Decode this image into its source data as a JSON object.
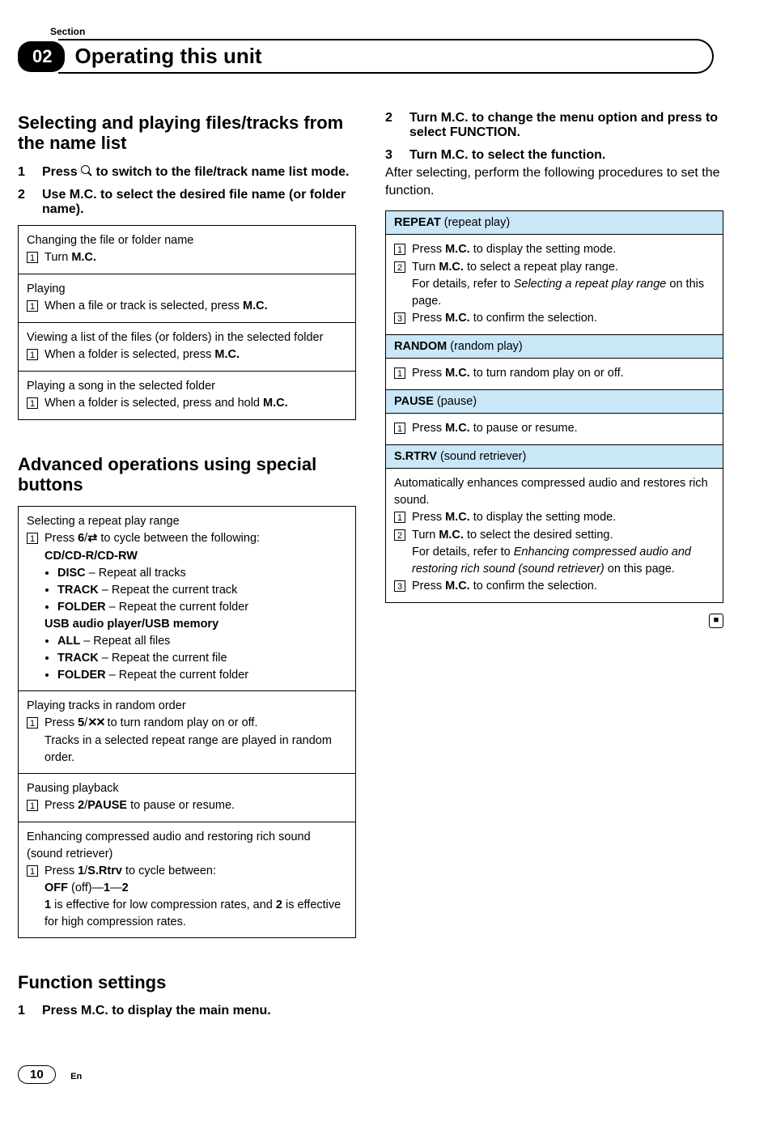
{
  "header": {
    "section_label": "Section",
    "chapter_number": "02",
    "chapter_title": "Operating this unit"
  },
  "left": {
    "h1": "Selecting and playing files/tracks from the name list",
    "step1_num": "1",
    "step1_a": "Press ",
    "step1_b": " to switch to the file/track name list mode.",
    "step2_num": "2",
    "step2": "Use M.C. to select the desired file name (or folder name).",
    "box1": {
      "r1_title": "Changing the file or folder name",
      "r1_item": "Turn ",
      "r1_item_b": "M.C.",
      "r2_title": "Playing",
      "r2_item_a": "When a file or track is selected, press ",
      "r2_item_b": "M.C.",
      "r3_title": "Viewing a list of the files (or folders) in the selected folder",
      "r3_item_a": "When a folder is selected, press ",
      "r3_item_b": "M.C.",
      "r4_title": "Playing a song in the selected folder",
      "r4_item_a": "When a folder is selected, press and hold ",
      "r4_item_b": "M.C."
    },
    "h2": "Advanced operations using special buttons",
    "box2": {
      "r1_title": "Selecting a repeat play range",
      "r1_press_a": "Press ",
      "r1_press_key": "6",
      "r1_press_b": " to cycle between the following:",
      "r1_sub1": "CD/CD-R/CD-RW",
      "r1_b1_b": "DISC",
      "r1_b1_t": " – Repeat all tracks",
      "r1_b2_b": "TRACK",
      "r1_b2_t": " – Repeat the current track",
      "r1_b3_b": "FOLDER",
      "r1_b3_t": " – Repeat the current folder",
      "r1_sub2": "USB audio player/USB memory",
      "r1_b4_b": "ALL",
      "r1_b4_t": " – Repeat all files",
      "r1_b5_b": "TRACK",
      "r1_b5_t": " – Repeat the current file",
      "r1_b6_b": "FOLDER",
      "r1_b6_t": " – Repeat the current folder",
      "r2_title": "Playing tracks in random order",
      "r2_press_a": "Press ",
      "r2_press_key": "5",
      "r2_press_b": " to turn random play on or off.",
      "r2_line2": "Tracks in a selected repeat range are played in random order.",
      "r3_title": "Pausing playback",
      "r3_press_a": "Press ",
      "r3_press_key": "2",
      "r3_press_key2": "PAUSE",
      "r3_press_b": " to pause or resume.",
      "r4_title": "Enhancing compressed audio and restoring rich sound (sound retriever)",
      "r4_press_a": "Press ",
      "r4_press_key": "1",
      "r4_press_key2": "S.Rtrv",
      "r4_press_b": " to cycle between:",
      "r4_line2_a": "OFF",
      "r4_line2_b": " (off)—",
      "r4_line2_c": "1",
      "r4_line2_d": "—",
      "r4_line2_e": "2",
      "r4_line3_a": "1",
      "r4_line3_b": " is effective for low compression rates, and ",
      "r4_line3_c": "2",
      "r4_line3_d": " is effective for high compression rates."
    },
    "h3": "Function settings",
    "fs_step1_num": "1",
    "fs_step1": "Press M.C. to display the main menu."
  },
  "right": {
    "step2_num": "2",
    "step2": "Turn M.C. to change the menu option and press to select FUNCTION.",
    "step3_num": "3",
    "step3": "Turn M.C. to select the function.",
    "after3": "After selecting, perform the following procedures to set the function.",
    "ft": {
      "h1_a": "REPEAT",
      "h1_b": " (repeat play)",
      "b1_1_a": "Press ",
      "b1_1_b": "M.C.",
      "b1_1_c": " to display the setting mode.",
      "b1_2_a": "Turn ",
      "b1_2_b": "M.C.",
      "b1_2_c": " to select a repeat play range.",
      "b1_2_d": "For details, refer to ",
      "b1_2_e": "Selecting a repeat play range",
      "b1_2_f": " on this page.",
      "b1_3_a": "Press ",
      "b1_3_b": "M.C.",
      "b1_3_c": " to confirm the selection.",
      "h2_a": "RANDOM",
      "h2_b": " (random play)",
      "b2_1_a": "Press ",
      "b2_1_b": "M.C.",
      "b2_1_c": " to turn random play on or off.",
      "h3_a": "PAUSE",
      "h3_b": " (pause)",
      "b3_1_a": "Press ",
      "b3_1_b": "M.C.",
      "b3_1_c": " to pause or resume.",
      "h4_a": "S.RTRV",
      "h4_b": " (sound retriever)",
      "b4_intro": "Automatically enhances compressed audio and restores rich sound.",
      "b4_1_a": "Press ",
      "b4_1_b": "M.C.",
      "b4_1_c": " to display the setting mode.",
      "b4_2_a": "Turn ",
      "b4_2_b": "M.C.",
      "b4_2_c": " to select the desired setting.",
      "b4_2_d": "For details, refer to ",
      "b4_2_e": "Enhancing compressed audio and restoring rich sound (sound retriever)",
      "b4_2_f": " on this page.",
      "b4_3_a": "Press ",
      "b4_3_b": "M.C.",
      "b4_3_c": " to confirm the selection."
    }
  },
  "footer": {
    "page": "10",
    "lang": "En"
  },
  "glyph": {
    "n1": "1",
    "n2": "2",
    "n3": "3",
    "end": "■"
  }
}
